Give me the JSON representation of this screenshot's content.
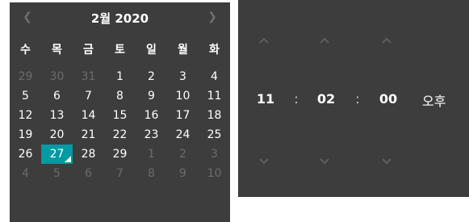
{
  "calendar": {
    "title": "2월 2020",
    "prev_icon": "chevron-left-icon",
    "next_icon": "chevron-right-icon",
    "weekdays": [
      "수",
      "목",
      "금",
      "토",
      "일",
      "월",
      "화"
    ],
    "weeks": [
      [
        {
          "d": "29",
          "other": true
        },
        {
          "d": "30",
          "other": true
        },
        {
          "d": "31",
          "other": true
        },
        {
          "d": "1"
        },
        {
          "d": "2"
        },
        {
          "d": "3"
        },
        {
          "d": "4"
        }
      ],
      [
        {
          "d": "5"
        },
        {
          "d": "6"
        },
        {
          "d": "7"
        },
        {
          "d": "8"
        },
        {
          "d": "9"
        },
        {
          "d": "10"
        },
        {
          "d": "11"
        }
      ],
      [
        {
          "d": "12"
        },
        {
          "d": "13"
        },
        {
          "d": "14"
        },
        {
          "d": "15"
        },
        {
          "d": "16"
        },
        {
          "d": "17"
        },
        {
          "d": "18"
        }
      ],
      [
        {
          "d": "19"
        },
        {
          "d": "20"
        },
        {
          "d": "21"
        },
        {
          "d": "22"
        },
        {
          "d": "23"
        },
        {
          "d": "24"
        },
        {
          "d": "25"
        }
      ],
      [
        {
          "d": "26"
        },
        {
          "d": "27",
          "selected": true
        },
        {
          "d": "28"
        },
        {
          "d": "29"
        },
        {
          "d": "1",
          "other": true
        },
        {
          "d": "2",
          "other": true
        },
        {
          "d": "3",
          "other": true
        }
      ],
      [
        {
          "d": "4",
          "other": true
        },
        {
          "d": "5",
          "other": true
        },
        {
          "d": "6",
          "other": true
        },
        {
          "d": "7",
          "other": true
        },
        {
          "d": "8",
          "other": true
        },
        {
          "d": "9",
          "other": true
        },
        {
          "d": "10",
          "other": true
        }
      ]
    ],
    "selected_color": "#009aa3"
  },
  "timepicker": {
    "hour": "11",
    "minute": "02",
    "second": "00",
    "separator": ":",
    "ampm": "오후",
    "up_icon": "chevron-up-icon",
    "down_icon": "chevron-down-icon"
  },
  "colors": {
    "panel_bg": "#3d3d3d",
    "text": "#ffffff",
    "muted": "#6b6b6b"
  }
}
